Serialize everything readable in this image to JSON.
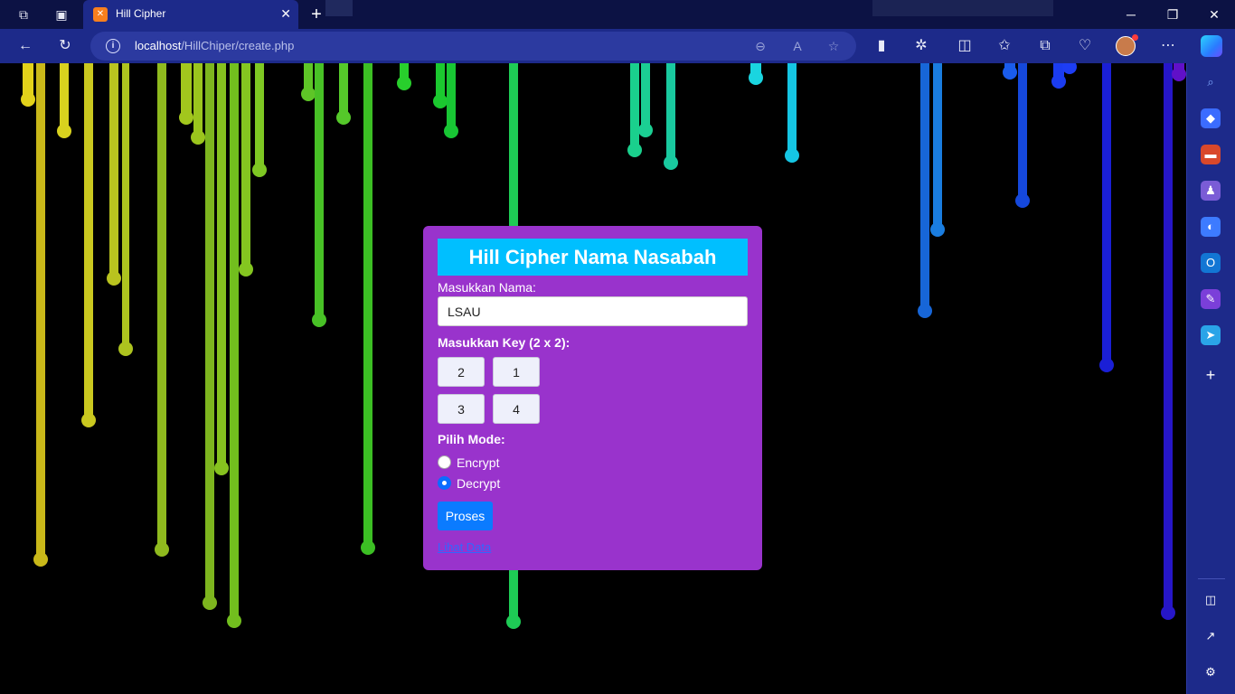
{
  "browser": {
    "tab_title": "Hill Cipher",
    "url_host": "localhost",
    "url_path": "/HillChiper/create.php"
  },
  "colors": {
    "titlebar_bg": "#0c1244",
    "toolbar_bg": "#1d2a8a",
    "card_bg": "#9933cc",
    "header_bg": "#00bfff",
    "button_bg": "#0b7bff",
    "link": "#2f68ff"
  },
  "form": {
    "title": "Hill Cipher Nama Nasabah",
    "nama_label": "Masukkan Nama:",
    "nama_value": "LSAU",
    "key_label": "Masukkan Key (2 x 2):",
    "keys": [
      "2",
      "1",
      "3",
      "4"
    ],
    "mode_label": "Pilih Mode:",
    "mode_encrypt": "Encrypt",
    "mode_decrypt": "Decrypt",
    "selected_mode": "Decrypt",
    "submit_label": "Proses",
    "link_label": "Lihat Data"
  }
}
